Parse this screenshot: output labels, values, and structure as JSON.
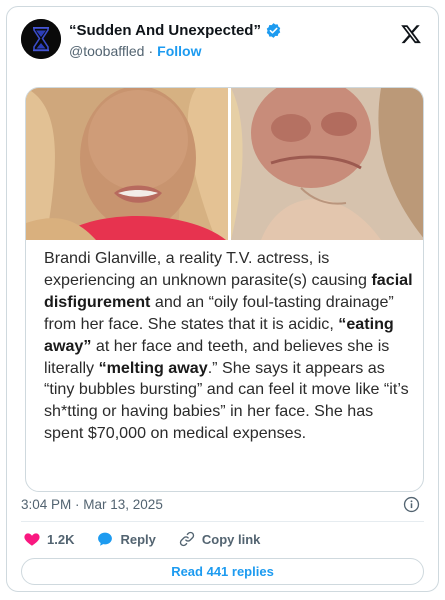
{
  "tweet": {
    "display_name": "“Sudden And Unexpected”",
    "handle": "@toobaffled",
    "separator": "·",
    "follow_label": "Follow",
    "timestamp": "3:04 PM · Mar 13, 2025"
  },
  "media": {
    "paragraph": [
      {
        "text": "Brandi Glanville, a reality T.V. actress, is experiencing an unknown parasite(s) causing ",
        "bold": false
      },
      {
        "text": "facial disfigurement",
        "bold": true
      },
      {
        "text": " and an “oily foul-tasting drainage” from her face. She states that it is acidic, ",
        "bold": false
      },
      {
        "text": "“eating away”",
        "bold": true
      },
      {
        "text": " at her face and teeth, and believes she is literally ",
        "bold": false
      },
      {
        "text": "“melting away",
        "bold": true
      },
      {
        "text": ".” She says it appears as “tiny bubbles bursting” and can feel it move like “it’s sh*tting or having babies” in her face. She has spent $70,000 on medical expenses.",
        "bold": false
      }
    ]
  },
  "actions": {
    "like_count": "1.2K",
    "reply_label": "Reply",
    "copy_link_label": "Copy link",
    "read_replies_label": "Read 441 replies"
  },
  "colors": {
    "accent": "#1d9bf0",
    "like": "#f91880",
    "muted": "#536471"
  },
  "icons": [
    "hourglass-avatar",
    "verified-badge-icon",
    "x-logo-icon",
    "info-icon",
    "heart-icon",
    "reply-bubble-icon",
    "link-icon"
  ]
}
